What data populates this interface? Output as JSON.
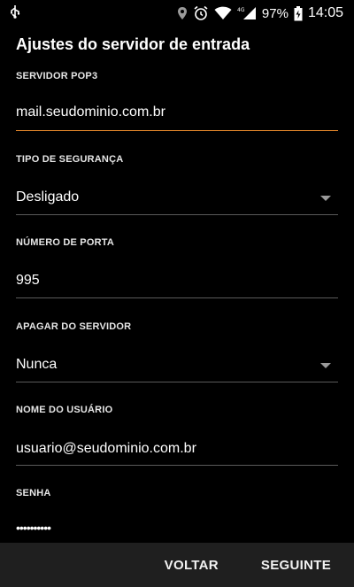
{
  "status_bar": {
    "network": "4G",
    "battery": "97%",
    "time": "14:05",
    "icons": [
      "usb-icon",
      "location-icon",
      "alarm-icon",
      "wifi-icon",
      "signal-icon",
      "battery-icon"
    ]
  },
  "page": {
    "title": "Ajustes do servidor de entrada"
  },
  "fields": {
    "pop3_server": {
      "label": "SERVIDOR POP3",
      "value": "mail.seudominio.com.br"
    },
    "security_type": {
      "label": "TIPO DE SEGURANÇA",
      "value": "Desligado"
    },
    "port_number": {
      "label": "NÚMERO DE PORTA",
      "value": "995"
    },
    "delete_from_server": {
      "label": "APAGAR DO SERVIDOR",
      "value": "Nunca"
    },
    "username": {
      "label": "NOME DO USUÁRIO",
      "value": "usuario@seudominio.com.br"
    },
    "password": {
      "label": "SENHA",
      "value": "••••••••••"
    }
  },
  "actions": {
    "back": "VOLTAR",
    "next": "SEGUINTE"
  },
  "colors": {
    "accent_underline": "#e8892b",
    "background": "#000000",
    "bottom_bar": "#1f1f1f"
  }
}
